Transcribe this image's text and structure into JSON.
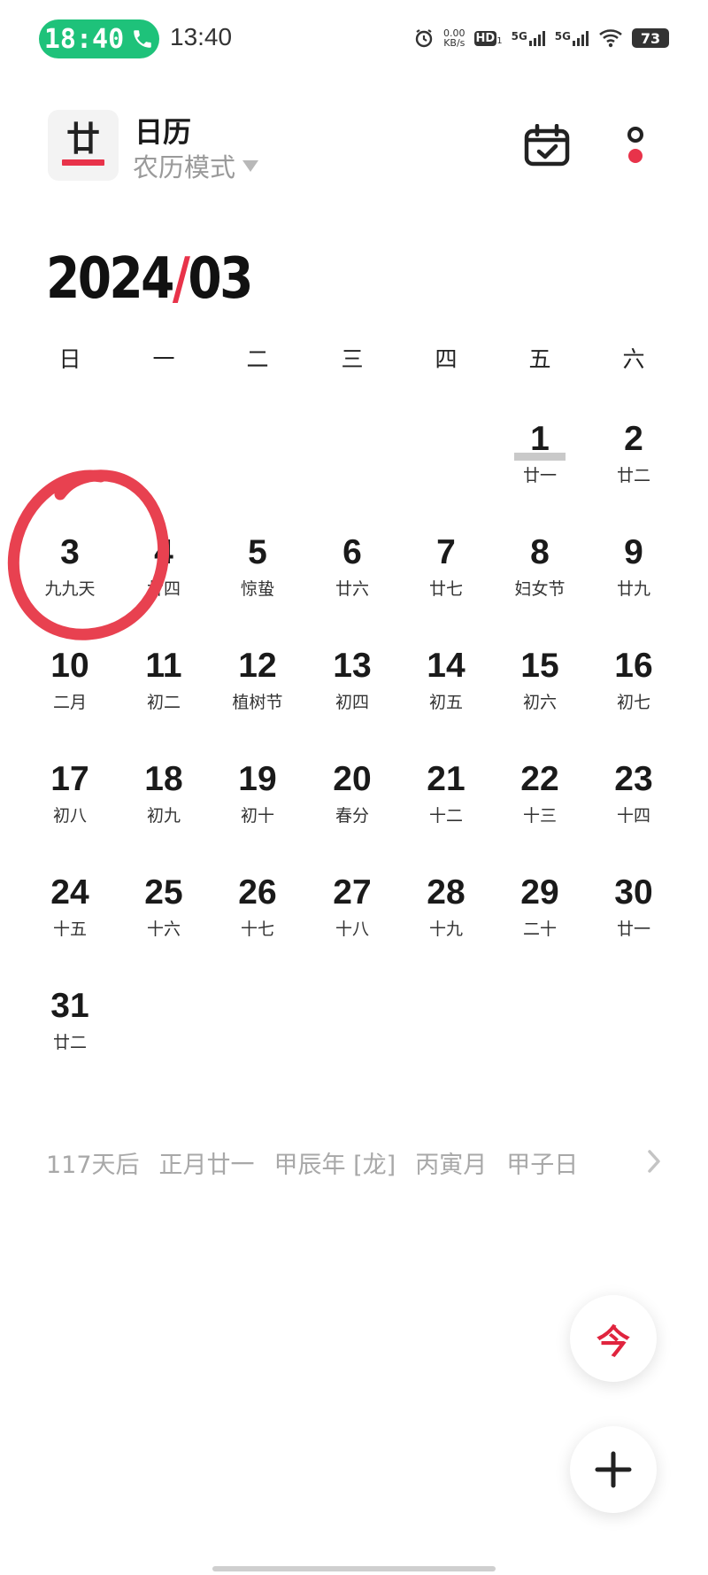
{
  "status_bar": {
    "call_time": "18:40",
    "clock": "13:40",
    "net_speed_value": "0.00",
    "net_speed_unit": "KB/s",
    "hd_label": "HD",
    "sim1_label": "5G",
    "sim2_label": "5G",
    "battery": "73"
  },
  "header": {
    "app_icon_glyph": "廿",
    "title": "日历",
    "mode_label": "农历模式"
  },
  "calendar": {
    "month_year": "2024",
    "month_sep": "/",
    "month_num": "03",
    "weekdays": [
      "日",
      "一",
      "二",
      "三",
      "四",
      "五",
      "六"
    ],
    "days": [
      {
        "num": "1",
        "lunar": "廿一"
      },
      {
        "num": "2",
        "lunar": "廿二"
      },
      {
        "num": "3",
        "lunar": "九九天"
      },
      {
        "num": "4",
        "lunar": "廿四"
      },
      {
        "num": "5",
        "lunar": "惊蛰"
      },
      {
        "num": "6",
        "lunar": "廿六"
      },
      {
        "num": "7",
        "lunar": "廿七"
      },
      {
        "num": "8",
        "lunar": "妇女节"
      },
      {
        "num": "9",
        "lunar": "廿九"
      },
      {
        "num": "10",
        "lunar": "二月"
      },
      {
        "num": "11",
        "lunar": "初二"
      },
      {
        "num": "12",
        "lunar": "植树节"
      },
      {
        "num": "13",
        "lunar": "初四"
      },
      {
        "num": "14",
        "lunar": "初五"
      },
      {
        "num": "15",
        "lunar": "初六"
      },
      {
        "num": "16",
        "lunar": "初七"
      },
      {
        "num": "17",
        "lunar": "初八"
      },
      {
        "num": "18",
        "lunar": "初九"
      },
      {
        "num": "19",
        "lunar": "初十"
      },
      {
        "num": "20",
        "lunar": "春分"
      },
      {
        "num": "21",
        "lunar": "十二"
      },
      {
        "num": "22",
        "lunar": "十三"
      },
      {
        "num": "23",
        "lunar": "十四"
      },
      {
        "num": "24",
        "lunar": "十五"
      },
      {
        "num": "25",
        "lunar": "十六"
      },
      {
        "num": "26",
        "lunar": "十七"
      },
      {
        "num": "27",
        "lunar": "十八"
      },
      {
        "num": "28",
        "lunar": "十九"
      },
      {
        "num": "29",
        "lunar": "二十"
      },
      {
        "num": "30",
        "lunar": "廿一"
      },
      {
        "num": "31",
        "lunar": "廿二"
      }
    ],
    "first_weekday_index": 5,
    "selected_day": "1",
    "circled_day": "3"
  },
  "info_line": {
    "countdown": "117天后",
    "lunar_date": "正月廿一",
    "year_ganzhi": "甲辰年 [龙]",
    "month_ganzhi": "丙寅月",
    "day_ganzhi": "甲子日"
  },
  "fab": {
    "today_label": "今"
  },
  "colors": {
    "accent": "#e8334a",
    "call_pill": "#1ec27a"
  }
}
